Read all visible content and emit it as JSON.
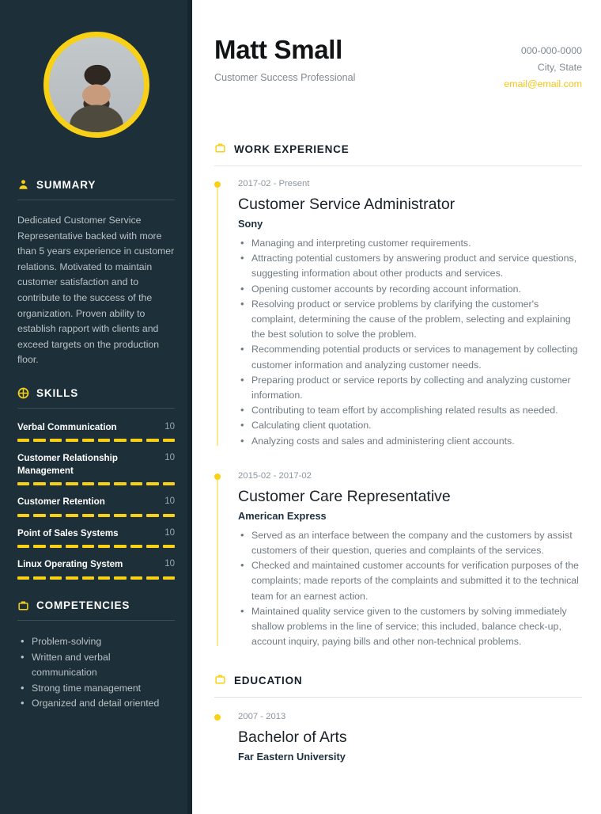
{
  "colors": {
    "sidebar_bg": "#1d2f38",
    "accent_yellow": "#f8d117",
    "email_yellow": "#f5c518",
    "sidebar_text": "#b9c2c6",
    "body_text": "#6e7a81"
  },
  "sidebar": {
    "avatar": {
      "alt": "profile-photo"
    },
    "summary": {
      "icon": "user-icon",
      "heading": "SUMMARY",
      "text": "Dedicated Customer Service Representative backed with more than 5 years experience in customer relations. Motivated to maintain customer satisfaction and to contribute to the success of the organization. Proven ability to establish rapport with clients and exceed targets on the production floor."
    },
    "skills": {
      "icon": "pie-chart-icon",
      "heading": "SKILLS",
      "max": 10,
      "items": [
        {
          "name": "Verbal Communication",
          "value": "10",
          "filled": 10
        },
        {
          "name": "Customer Relationship Management",
          "value": "10",
          "filled": 10
        },
        {
          "name": "Customer Retention",
          "value": "10",
          "filled": 10
        },
        {
          "name": "Point of Sales Systems",
          "value": "10",
          "filled": 10
        },
        {
          "name": "Linux Operating System",
          "value": "10",
          "filled": 10
        }
      ]
    },
    "competencies": {
      "icon": "briefcase-icon",
      "heading": "COMPETENCIES",
      "items": [
        "Problem-solving",
        "Written and verbal communication",
        "Strong time management",
        "Organized and detail oriented"
      ]
    }
  },
  "header": {
    "name": "Matt Small",
    "role": "Customer Success Professional",
    "phone": "000-000-0000",
    "location": "City, State",
    "email": "email@email.com"
  },
  "work": {
    "icon": "briefcase-icon",
    "heading": "WORK EXPERIENCE",
    "entries": [
      {
        "date": "2017-02 - Present",
        "title": "Customer Service Administrator",
        "org": "Sony",
        "bullets": [
          "Managing and interpreting customer requirements.",
          "Attracting potential customers by answering product and service questions, suggesting information about other products and services.",
          "Opening customer accounts by recording account information.",
          "Resolving product or service problems by clarifying the customer's complaint, determining the cause of the problem, selecting and explaining the best solution to solve the problem.",
          "Recommending potential products or services to management by collecting customer information and analyzing customer needs.",
          "Preparing product or service reports by collecting and analyzing customer information.",
          "Contributing to team effort by accomplishing related results as needed.",
          "Calculating client quotation.",
          "Analyzing costs and sales and administering client accounts."
        ]
      },
      {
        "date": "2015-02 - 2017-02",
        "title": "Customer Care Representative",
        "org": "American Express",
        "bullets": [
          "Served as an interface between the company and the customers by assist customers of their question, queries and complaints of the services.",
          "Checked and maintained customer accounts for verification purposes of the complaints; made reports of the complaints and submitted it to the technical team for an earnest action.",
          "Maintained quality service given to the customers by solving immediately shallow problems in the line of service; this included, balance check-up, account inquiry, paying bills and other non-technical problems."
        ]
      }
    ]
  },
  "education": {
    "icon": "briefcase-icon",
    "heading": "EDUCATION",
    "entries": [
      {
        "date": "2007 - 2013",
        "title": "Bachelor of Arts",
        "org": "Far Eastern University"
      }
    ]
  }
}
